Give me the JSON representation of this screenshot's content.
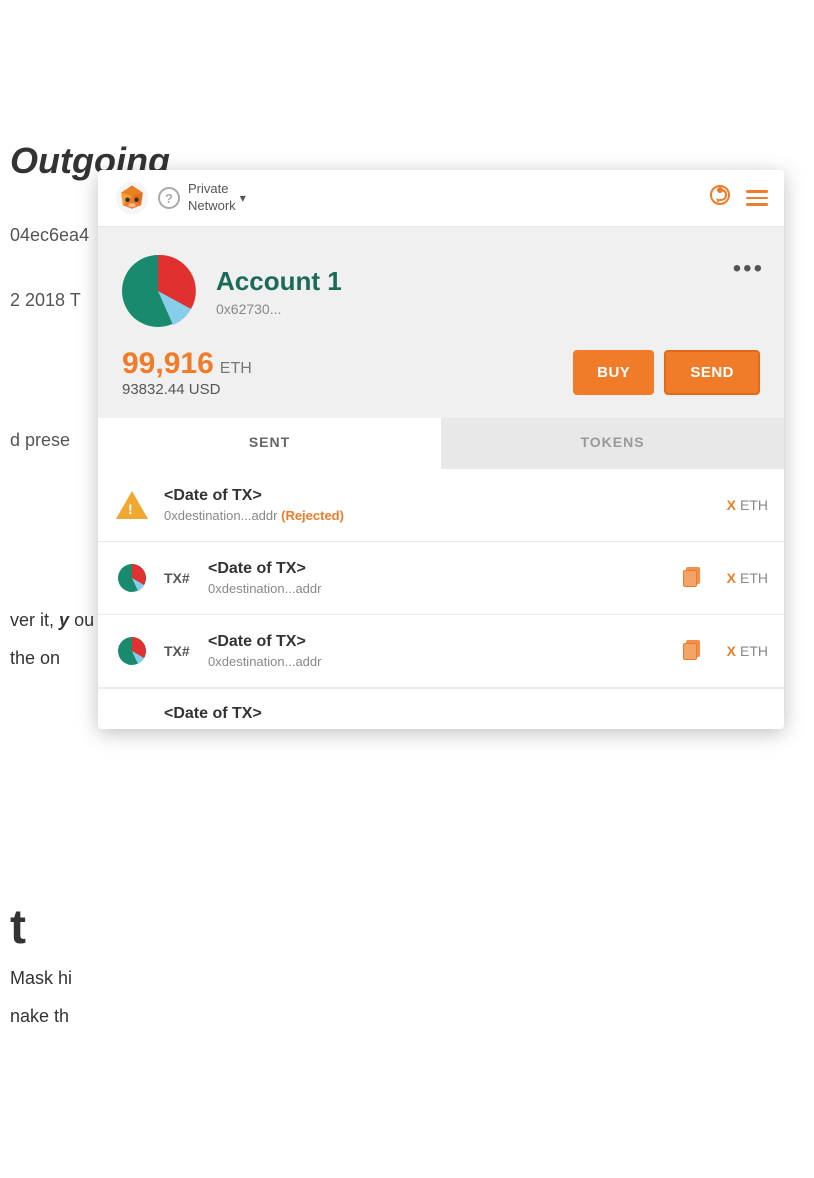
{
  "browser": {
    "topbar_bg": "#2b2b2b",
    "profile_icon": "👤",
    "star_icon": "☆",
    "metamask_icon": "🦊",
    "more_icon": "⋮"
  },
  "background": {
    "outgoing_label": "Outgoing",
    "address_partial": "04ec6ea4",
    "date_partial": "2 2018 T",
    "press_text": "d prese",
    "ver_text": "ver it,",
    "ver_bold": "y",
    "the_text": "the on",
    "t_letter": "t",
    "mask_line1": "Mask hi",
    "mask_line2": "nake th"
  },
  "popup": {
    "network": {
      "label_line1": "Private",
      "label_line2": "Network",
      "chevron": "▾"
    },
    "header_icons": {
      "help": "?",
      "refresh": "↻",
      "menu": "☰"
    },
    "account": {
      "name": "Account 1",
      "address": "0x62730...",
      "more_label": "•••",
      "balance_eth": "99,916",
      "balance_eth_unit": "ETH",
      "balance_usd": "93832.44 USD",
      "buy_label": "BUY",
      "send_label": "SEND"
    },
    "tabs": [
      {
        "id": "sent",
        "label": "SENT",
        "active": true
      },
      {
        "id": "tokens",
        "label": "TOKENS",
        "active": false
      }
    ],
    "transactions": [
      {
        "id": "tx1",
        "type": "rejected",
        "date": "<Date of TX>",
        "address": "0xdestination...addr",
        "status": "Rejected",
        "amount_x": "X",
        "amount_unit": "ETH"
      },
      {
        "id": "tx2",
        "type": "normal",
        "tx_num": "TX#",
        "date": "<Date of TX>",
        "address": "0xdestination...addr",
        "amount_x": "X",
        "amount_unit": "ETH"
      },
      {
        "id": "tx3",
        "type": "normal",
        "tx_num": "TX#",
        "date": "<Date of TX>",
        "address": "0xdestination...addr",
        "amount_x": "X",
        "amount_unit": "ETH"
      },
      {
        "id": "tx4",
        "type": "partial",
        "date": "<Date of TX>"
      }
    ]
  }
}
